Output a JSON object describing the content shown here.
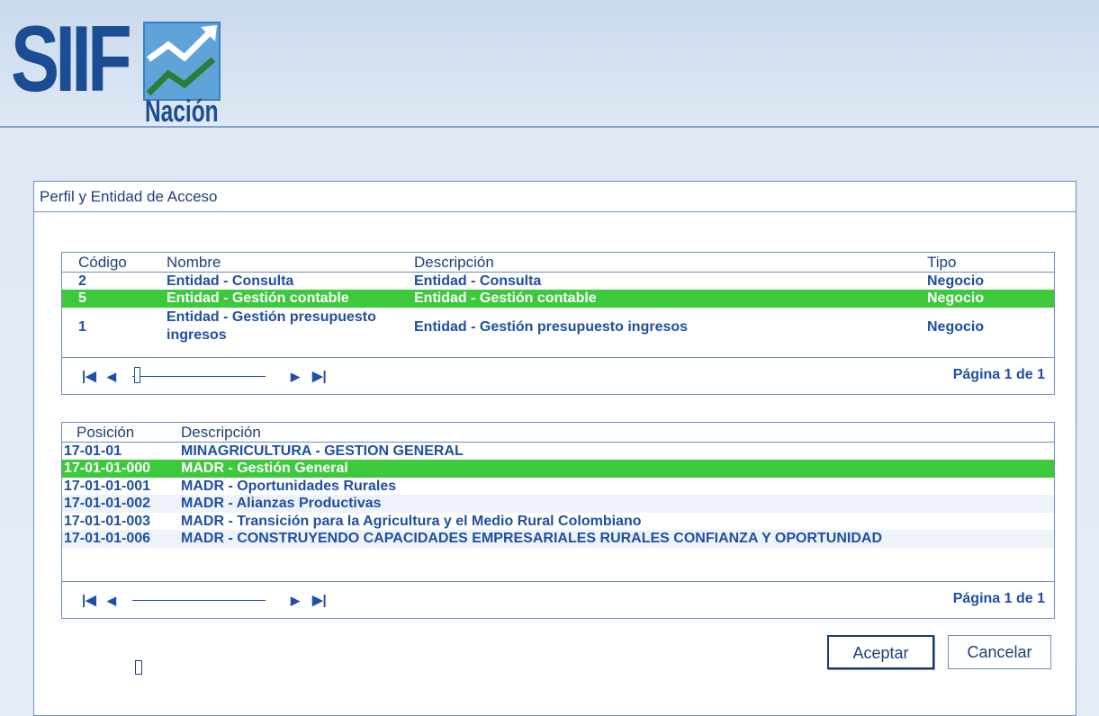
{
  "logo": {
    "brand": "SIIF",
    "sub": "Nación"
  },
  "panel": {
    "title": "Perfil y Entidad de Acceso"
  },
  "profiles": {
    "headers": {
      "codigo": "Código",
      "nombre": "Nombre",
      "descripcion": "Descripción",
      "tipo": "Tipo"
    },
    "rows": [
      {
        "codigo": "2",
        "nombre": "Entidad - Consulta",
        "nombre2": "",
        "descripcion": "Entidad - Consulta",
        "tipo": "Negocio",
        "selected": false
      },
      {
        "codigo": "5",
        "nombre": "Entidad - Gestión contable",
        "nombre2": "",
        "descripcion": "Entidad - Gestión contable",
        "tipo": "Negocio",
        "selected": true
      },
      {
        "codigo": "1",
        "nombre": "Entidad - Gestión presupuesto",
        "nombre2": "ingresos",
        "descripcion": "Entidad - Gestión presupuesto ingresos",
        "tipo": "Negocio",
        "selected": false
      }
    ],
    "pager": {
      "text": "Página 1 de 1"
    }
  },
  "positions": {
    "headers": {
      "posicion": "Posición",
      "descripcion": "Descripción"
    },
    "rows": [
      {
        "posicion": "17-01-01",
        "descripcion": "MINAGRICULTURA - GESTION GENERAL",
        "selected": false
      },
      {
        "posicion": "17-01-01-000",
        "descripcion": "MADR - Gestión General",
        "selected": true
      },
      {
        "posicion": "17-01-01-001",
        "descripcion": "MADR - Oportunidades Rurales",
        "selected": false
      },
      {
        "posicion": "17-01-01-002",
        "descripcion": "MADR - Alianzas Productivas",
        "selected": false
      },
      {
        "posicion": "17-01-01-003",
        "descripcion": "MADR - Transición para la Agricultura y el Medio Rural Colombiano",
        "selected": false
      },
      {
        "posicion": "17-01-01-006",
        "descripcion": "MADR - CONSTRUYENDO CAPACIDADES EMPRESARIALES RURALES CONFIANZA Y OPORTUNIDAD",
        "selected": false
      }
    ],
    "pager": {
      "text": "Página 1 de 1"
    }
  },
  "buttons": {
    "accept": "Aceptar",
    "cancel": "Cancelar"
  },
  "pager_icons": {
    "first": "first-page-icon",
    "prev": "previous-page-icon",
    "next": "next-page-icon",
    "last": "last-page-icon"
  },
  "colors": {
    "selected_row": "#3cc93c",
    "text": "#1f4ea5",
    "border": "#6b8fc4"
  }
}
